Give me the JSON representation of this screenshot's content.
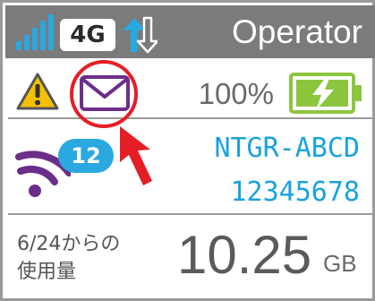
{
  "status_bar": {
    "network_type": "4G",
    "operator": "Operator",
    "icons": [
      "signal-strength-icon",
      "data-transfer-icon"
    ],
    "colors": {
      "background": "#7b7b7b",
      "signal": "#29a7df",
      "text": "#ffffff"
    }
  },
  "alerts": {
    "icons": [
      "warning-icon",
      "mail-icon"
    ],
    "battery_percent": "100%",
    "colors": {
      "warning": "#f5c000",
      "mail": "#6b2e8a",
      "highlight": "#e41e26",
      "battery": "#8cc63f"
    }
  },
  "wifi": {
    "connected_clients": "12",
    "ssid": "NTGR-ABCD",
    "password": "12345678",
    "colors": {
      "icon": "#6b2e8a",
      "badge": "#2aa8e0",
      "text": "#19a3dd"
    }
  },
  "usage": {
    "caption_line1": "6/24からの",
    "caption_line2": "使用量",
    "value": "10.25",
    "unit": "GB"
  }
}
